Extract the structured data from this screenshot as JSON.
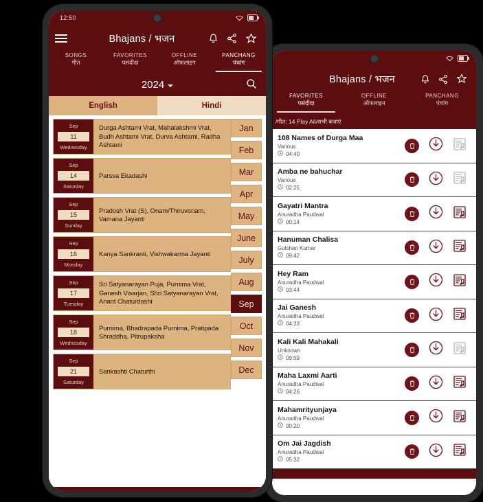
{
  "app": {
    "title": "Bhajans / भजन",
    "brand_color": "#5c0d10",
    "accent_tan": "#ddb380",
    "accent_tan_light": "#efdcc3"
  },
  "left_phone": {
    "status": {
      "clock": "12:50",
      "wifi_icon": "wifi-icon",
      "battery_icon": "battery-icon"
    },
    "appbar": {
      "menu_icon": "hamburger-icon",
      "title": "Bhajans / भजन",
      "bell_icon": "bell-icon",
      "share_icon": "share-icon",
      "star_icon": "star-icon"
    },
    "tabs": [
      {
        "en": "SONGS",
        "hi": "गीत",
        "active": false
      },
      {
        "en": "FAVORITES",
        "hi": "पसंदीदा",
        "active": false
      },
      {
        "en": "OFFLINE",
        "hi": "ऑफलाइन",
        "active": false
      },
      {
        "en": "PANCHANG",
        "hi": "पंचांग",
        "active": true
      }
    ],
    "year_bar": {
      "year": "2024",
      "caret_icon": "chevron-down-icon",
      "search_icon": "search-icon"
    },
    "language_tabs": [
      {
        "label": "English",
        "selected": true
      },
      {
        "label": "Hindi",
        "selected": false
      }
    ],
    "events": [
      {
        "month": "Sep",
        "day": "11",
        "dow": "Wednesday",
        "desc": "Durga Ashtami Vrat, Mahalakshmi Vrat, Budh Ashtami Vrat, Durva Ashtami, Radha Ashtami"
      },
      {
        "month": "Sep",
        "day": "14",
        "dow": "Saturday",
        "desc": "Parsva Ekadashi"
      },
      {
        "month": "Sep",
        "day": "15",
        "dow": "Sunday",
        "desc": "Pradosh Vrat (S), Onam/Thiruvonam, Vamana Jayanti"
      },
      {
        "month": "Sep",
        "day": "16",
        "dow": "Monday",
        "desc": "Kanya Sankranti, Vishwakarma Jayanti"
      },
      {
        "month": "Sep",
        "day": "17",
        "dow": "Tuesday",
        "desc": "Sri Satyanarayan Puja, Purnima Vrat, Ganesh Visarjan, Shri Satyanarayan Vrat, Anant Chaturdashi"
      },
      {
        "month": "Sep",
        "day": "18",
        "dow": "Wednesday",
        "desc": "Purnima, Bhadrapada Purnima, Pratipada Shraddha, Pitrupaksha"
      },
      {
        "month": "Sep",
        "day": "21",
        "dow": "Saturday",
        "desc": "Sankashti Chaturthi"
      }
    ],
    "months": [
      {
        "label": "Jan",
        "selected": false
      },
      {
        "label": "Feb",
        "selected": false
      },
      {
        "label": "Mar",
        "selected": false
      },
      {
        "label": "Apr",
        "selected": false
      },
      {
        "label": "May",
        "selected": false
      },
      {
        "label": "June",
        "selected": false
      },
      {
        "label": "July",
        "selected": false
      },
      {
        "label": "Aug",
        "selected": false
      },
      {
        "label": "Sep",
        "selected": true
      },
      {
        "label": "Oct",
        "selected": false
      },
      {
        "label": "Nov",
        "selected": false
      },
      {
        "label": "Dec",
        "selected": false
      }
    ]
  },
  "right_phone": {
    "status": {
      "wifi_icon": "wifi-icon",
      "battery_icon": "battery-icon"
    },
    "appbar": {
      "title": "Bhajans / भजन",
      "bell_icon": "bell-icon",
      "share_icon": "share-icon",
      "star_icon": "star-icon"
    },
    "tabs": [
      {
        "en": "FAVORITES",
        "hi": "पसंदीदा",
        "active": true
      },
      {
        "en": "OFFLINE",
        "hi": "ऑफलाइन",
        "active": false
      },
      {
        "en": "PANCHANG",
        "hi": "पंचांग",
        "active": false
      }
    ],
    "play_all_bar": "/गीत: 14 Play All/सभी बजाएं",
    "songs": [
      {
        "title": "108 Names of Durga Maa",
        "artist": "Various",
        "duration": "04:40",
        "queue_enabled": false
      },
      {
        "title": "Amba ne bahuchar",
        "artist": "Various",
        "duration": "02:25",
        "queue_enabled": false
      },
      {
        "title": "Gayatri Mantra",
        "artist": "Anuradha Paudwal",
        "duration": "00:14",
        "queue_enabled": true
      },
      {
        "title": "Hanuman Chalisa",
        "artist": "Gulshan Kumar",
        "duration": "09:42",
        "queue_enabled": true
      },
      {
        "title": "Hey Ram",
        "artist": "Anuradha Paudwal",
        "duration": "03:44",
        "queue_enabled": true
      },
      {
        "title": "Jai Ganesh",
        "artist": "Anuradha Paudwal",
        "duration": "04:33",
        "queue_enabled": true
      },
      {
        "title": "Kali Kali Mahakali",
        "artist": "Unknown",
        "duration": "09:59",
        "queue_enabled": false
      },
      {
        "title": "Maha Laxmi Aarti",
        "artist": "Anuradha Paudwal",
        "duration": "04:26",
        "queue_enabled": true
      },
      {
        "title": "Mahamrityunjaya",
        "artist": "Anuradha Paudwal",
        "duration": "00:20",
        "queue_enabled": true
      },
      {
        "title": "Om Jai Jagdish",
        "artist": "Anuradha Paudwal",
        "duration": "05:32",
        "queue_enabled": true
      }
    ],
    "row_icons": {
      "delete": "trash-icon",
      "download": "download-circle-icon",
      "queue": "playlist-queue-icon",
      "clock": "clock-icon"
    }
  }
}
